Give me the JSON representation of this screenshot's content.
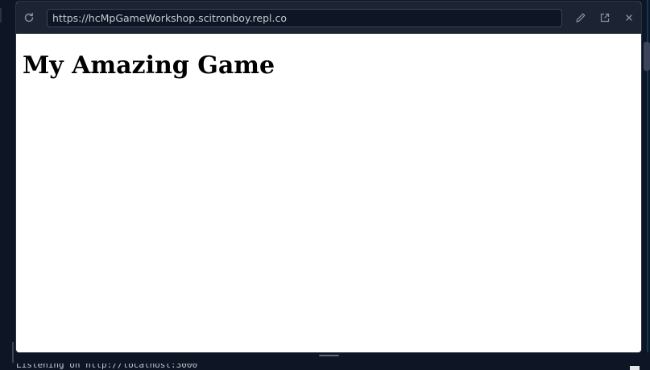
{
  "webview": {
    "url": "https://hcMpGameWorkshop.scitronboy.repl.co",
    "reload_icon": "reload-icon",
    "edit_icon": "pencil-icon",
    "open_icon": "external-link-icon",
    "close_icon": "close-icon"
  },
  "page": {
    "heading": "My Amazing Game"
  },
  "console": {
    "line": "Listening on http://localhost:3000"
  },
  "colors": {
    "ide_background": "#0e1525",
    "toolbar_background": "#1c2333",
    "url_field_background": "#0e1525",
    "page_background": "#ffffff"
  }
}
